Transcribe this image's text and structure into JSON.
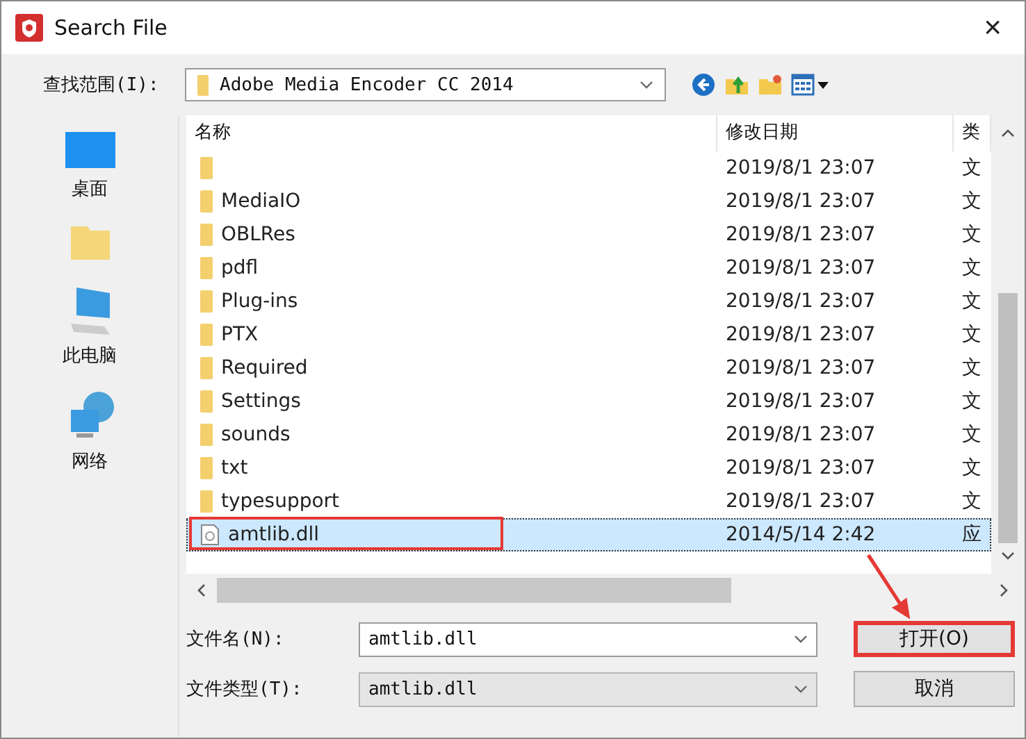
{
  "window": {
    "title": "Search File",
    "close": "×"
  },
  "look_in": {
    "label": "查找范围(I):",
    "value": "Adobe Media Encoder CC 2014"
  },
  "sidebar": {
    "items": [
      {
        "kind": "desktop",
        "label": "桌面",
        "selected": false
      },
      {
        "kind": "folder",
        "selected": false
      },
      {
        "kind": "computer",
        "label": "此电脑",
        "selected": false
      },
      {
        "kind": "network",
        "label": "网络",
        "selected": false
      }
    ]
  },
  "table": {
    "columns": [
      "名称",
      "修改日期",
      "类"
    ],
    "rows": [
      {
        "kind": "folder",
        "date": "2019/8/1 23:07",
        "type": "文",
        "selected": false
      },
      {
        "kind": "folder",
        "name": "MediaIO",
        "date": "2019/8/1 23:07",
        "type": "文",
        "selected": false
      },
      {
        "kind": "folder",
        "name": "OBLRes",
        "date": "2019/8/1 23:07",
        "type": "文",
        "selected": false
      },
      {
        "kind": "folder",
        "name": "pdfl",
        "date": "2019/8/1 23:07",
        "type": "文",
        "selected": false
      },
      {
        "kind": "folder",
        "name": "Plug-ins",
        "date": "2019/8/1 23:07",
        "type": "文",
        "selected": false
      },
      {
        "kind": "folder",
        "name": "PTX",
        "date": "2019/8/1 23:07",
        "type": "文",
        "selected": false
      },
      {
        "kind": "folder",
        "name": "Required",
        "date": "2019/8/1 23:07",
        "type": "文",
        "selected": false
      },
      {
        "kind": "folder",
        "name": "Settings",
        "date": "2019/8/1 23:07",
        "type": "文",
        "selected": false
      },
      {
        "kind": "folder",
        "name": "sounds",
        "date": "2019/8/1 23:07",
        "type": "文",
        "selected": false
      },
      {
        "kind": "folder",
        "name": "txt",
        "date": "2019/8/1 23:07",
        "type": "文",
        "selected": false
      },
      {
        "kind": "folder",
        "name": "typesupport",
        "date": "2019/8/1 23:07",
        "type": "文",
        "selected": false
      },
      {
        "kind": "file",
        "name": "amtlib.dll",
        "date": "2014/5/14 2:42",
        "type": "应",
        "selected": true
      }
    ]
  },
  "file_name": {
    "label": "文件名(N):",
    "value": "amtlib.dll"
  },
  "file_type": {
    "label": "文件类型(T):",
    "value": "amtlib.dll"
  },
  "buttons": [
    {
      "label": "打开(O)",
      "highlighted": true
    },
    {
      "label": "取消",
      "highlighted": false
    }
  ]
}
